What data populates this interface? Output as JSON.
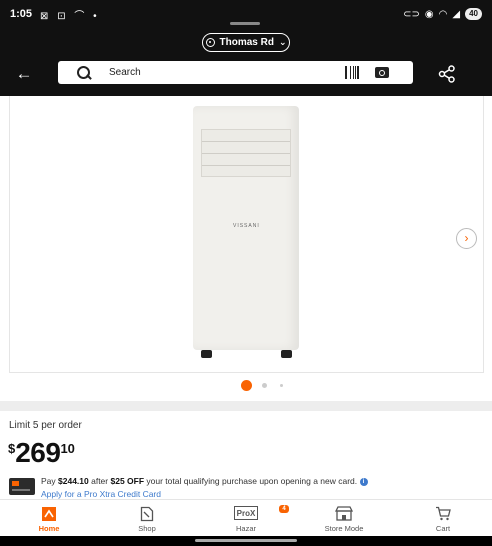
{
  "status_bar": {
    "time": "1:05",
    "left_icons": "⊠ ⊡ ⌒ •",
    "battery": "40",
    "icons": [
      "link-icon",
      "location-icon",
      "wifi-icon",
      "signal-icon",
      "battery-icon"
    ]
  },
  "header": {
    "store_name": "Thomas Rd",
    "search_placeholder": "Search",
    "icons": [
      "back-arrow-icon",
      "search-icon",
      "barcode-scan-icon",
      "camera-icon",
      "share-icon"
    ]
  },
  "product": {
    "image_brand_text": "VISSANI",
    "carousel_total": 3,
    "carousel_active": 1,
    "limit_text": "Limit 5 per order",
    "price": {
      "currency": "$",
      "dollars": "269",
      "cents": "10"
    },
    "promo": {
      "prefix": "Pay ",
      "discounted_price": "$244.10",
      "middle": " after ",
      "discount": "$25 OFF",
      "suffix": " your total qualifying purchase upon opening a new card.",
      "apply_link": "Apply for a Pro Xtra Credit Card"
    }
  },
  "bottom_nav": {
    "items": [
      {
        "label": "Home",
        "icon": "home-depot-logo-icon",
        "active": true
      },
      {
        "label": "Shop",
        "icon": "shop-icon",
        "active": false
      },
      {
        "label": "Hazar",
        "icon": "pro-xtra-icon",
        "active": false,
        "badge": "4"
      },
      {
        "label": "Store Mode",
        "icon": "store-icon",
        "active": false
      },
      {
        "label": "Cart",
        "icon": "cart-icon",
        "active": false
      }
    ]
  },
  "colors": {
    "accent": "#f96302",
    "header_bg": "#111111",
    "link": "#3e7acc"
  }
}
